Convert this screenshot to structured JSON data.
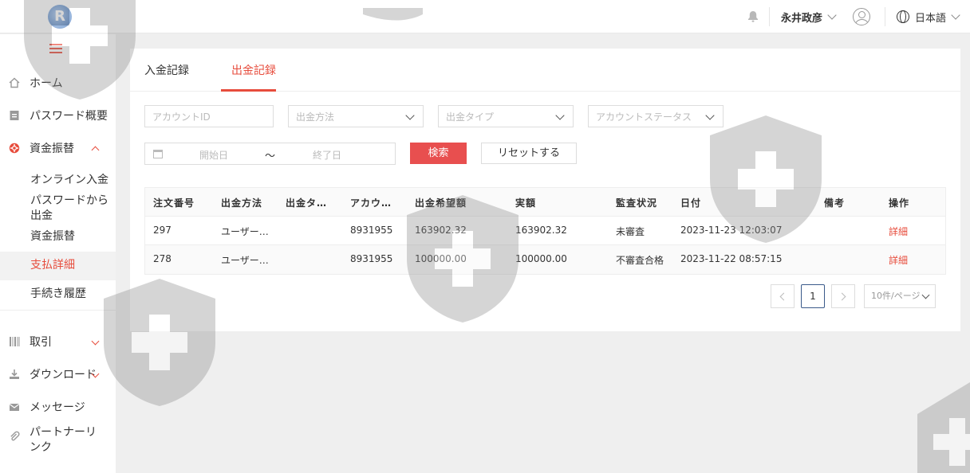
{
  "header": {
    "logo_letter": "R",
    "user_name": "永井政彦",
    "language": "日本語"
  },
  "sidebar": {
    "items": [
      {
        "label": "ホーム",
        "icon": "home-icon"
      },
      {
        "label": "パスワード概要",
        "icon": "document-icon"
      },
      {
        "label": "資金振替",
        "icon": "transfer-icon"
      },
      {
        "label": "取引",
        "icon": "barcode-icon"
      },
      {
        "label": "ダウンロード",
        "icon": "download-icon"
      },
      {
        "label": "メッセージ",
        "icon": "mail-icon"
      },
      {
        "label": "パートナーリンク",
        "icon": "paperclip-icon"
      }
    ],
    "sub_items": [
      "オンライン入金",
      "パスワードから出金",
      "資金振替",
      "支払詳細",
      "手続き履歴"
    ]
  },
  "tabs": [
    "入金記録",
    "出金記録"
  ],
  "filters": {
    "account_id_placeholder": "アカウントID",
    "withdraw_method_placeholder": "出金方法",
    "withdraw_type_placeholder": "出金タイプ",
    "account_status_placeholder": "アカウントステータス",
    "start_date_placeholder": "開始日",
    "date_separator": "～",
    "end_date_placeholder": "終了日",
    "search_label": "検索",
    "reset_label": "リセットする"
  },
  "table": {
    "headers": [
      "注文番号",
      "出金方法",
      "出金タ…",
      "アカウ…",
      "出金希望額",
      "実額",
      "監査状況",
      "日付",
      "備考",
      "操作"
    ],
    "rows": [
      [
        "297",
        "ユーザー…",
        "",
        "8931955",
        "163902.32",
        "163902.32",
        "未審査",
        "2023-11-23 12:03:07",
        "",
        "詳細"
      ],
      [
        "278",
        "ユーザー…",
        "",
        "8931955",
        "100000.00",
        "100000.00",
        "不審査合格",
        "2023-11-22 08:57:15",
        "",
        "詳細"
      ]
    ]
  },
  "pagination": {
    "current_page": "1",
    "page_size": "10件/ページ"
  },
  "colors": {
    "accent": "#e74c3c",
    "primary_button": "#e84f4f",
    "logo_blue": "#3a6fb8"
  }
}
